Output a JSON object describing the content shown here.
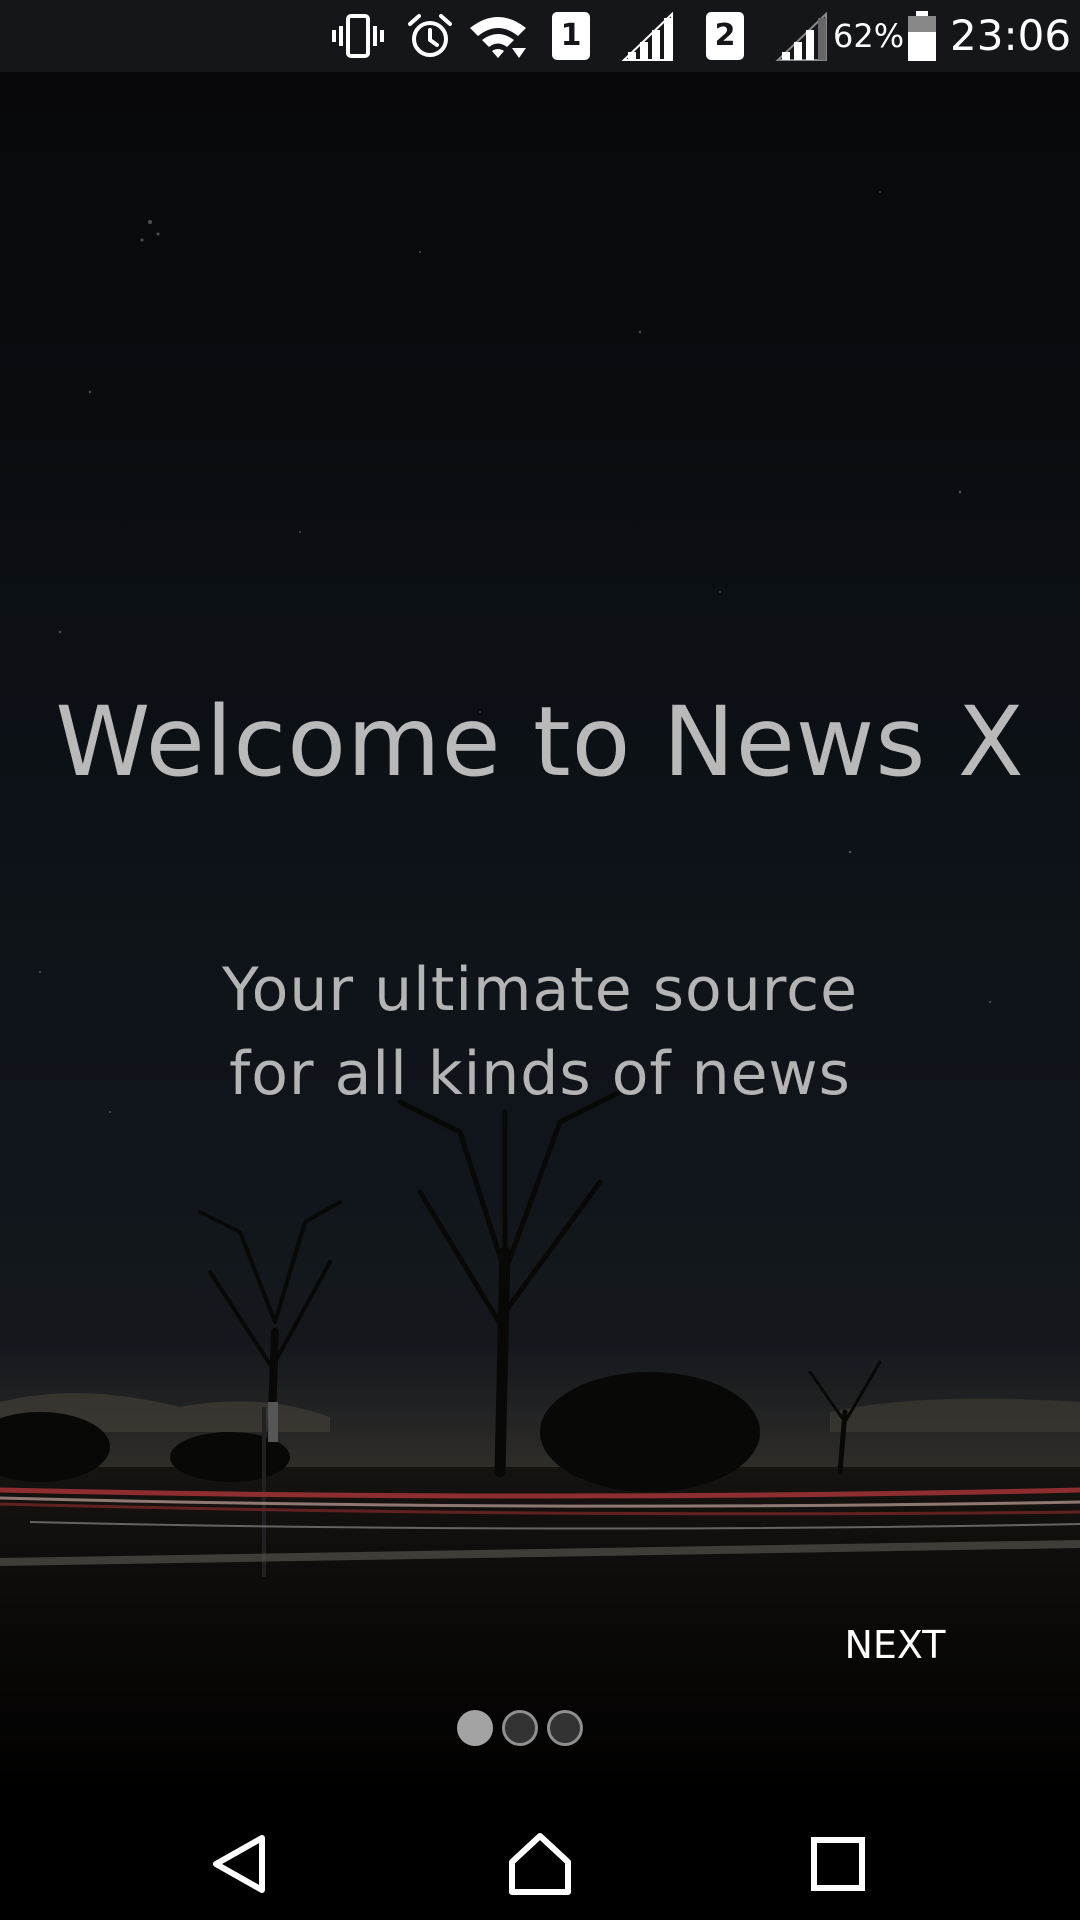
{
  "status_bar": {
    "battery_percent": "62%",
    "time": "23:06",
    "sim1_label": "1",
    "sim2_label": "2",
    "icons": [
      "vibrate-icon",
      "alarm-icon",
      "wifi-icon",
      "sim-1-icon",
      "signal-1-icon",
      "sim-2-icon",
      "signal-2-icon",
      "battery-icon"
    ]
  },
  "onboarding": {
    "title": "Welcome to News X",
    "subtitle": "Your ultimate source for all kinds of news",
    "next_label": "NEXT",
    "page_count": 3,
    "current_page": 1
  },
  "nav_bar": {
    "icons": [
      "back-icon",
      "home-icon",
      "recents-icon"
    ]
  },
  "colors": {
    "status_bar_bg": "#15161a",
    "text_primary": "#b9b9b9",
    "next_text": "#ffffff",
    "dot_active": "#a3a3a3",
    "dot_inactive": "#333333"
  }
}
